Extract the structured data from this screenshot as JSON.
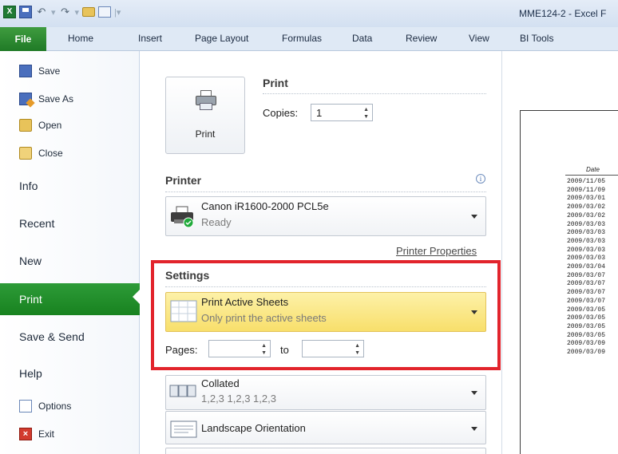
{
  "window": {
    "title": "MME124-2 - Excel F"
  },
  "ribbon": {
    "file_tab": "File",
    "tabs": [
      "Home",
      "Insert",
      "Page Layout",
      "Formulas",
      "Data",
      "Review",
      "View",
      "BI Tools"
    ]
  },
  "nav": {
    "save": "Save",
    "save_as": "Save As",
    "open": "Open",
    "close": "Close",
    "info": "Info",
    "recent": "Recent",
    "new": "New",
    "print": "Print",
    "save_send": "Save & Send",
    "help": "Help",
    "options": "Options",
    "exit": "Exit"
  },
  "print": {
    "title": "Print",
    "button_label": "Print",
    "copies_label": "Copies:",
    "copies_value": "1"
  },
  "printer": {
    "title": "Printer",
    "info_icon": "i",
    "name": "Canon iR1600-2000 PCL5e",
    "status": "Ready",
    "properties_link": "Printer Properties"
  },
  "settings": {
    "title": "Settings",
    "scope_main": "Print Active Sheets",
    "scope_sub": "Only print the active sheets",
    "pages_label": "Pages:",
    "pages_from": "",
    "pages_to_label": "to",
    "pages_to": "",
    "collation_main": "Collated",
    "collation_sub": "1,2,3   1,2,3   1,2,3",
    "orientation": "Landscape Orientation"
  },
  "preview": {
    "header": "Date",
    "dates": [
      "2009/11/05",
      "2009/11/09",
      "2009/03/01",
      "2009/03/02",
      "2009/03/02",
      "2009/03/03",
      "2009/03/03",
      "2009/03/03",
      "2009/03/03",
      "2009/03/03",
      "2009/03/04",
      "2009/03/07",
      "2009/03/07",
      "2009/03/07",
      "2009/03/07",
      "2009/03/05",
      "2009/03/05",
      "2009/03/05",
      "2009/03/05",
      "2009/03/09",
      "2009/03/09"
    ]
  }
}
